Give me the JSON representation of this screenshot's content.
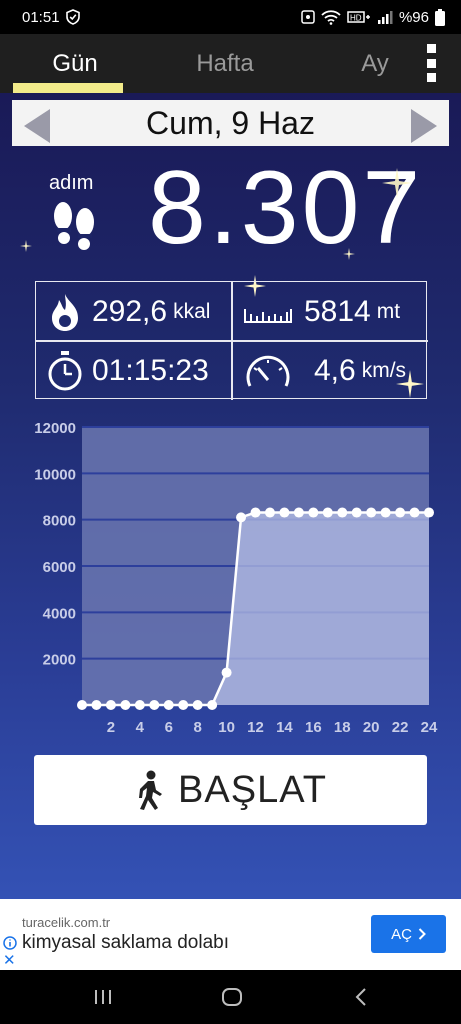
{
  "status_bar": {
    "time": "01:51",
    "battery": "%96",
    "icons": [
      "shield-check-icon",
      "alarm-icon",
      "wifi-icon",
      "volte-icon",
      "signal-icon",
      "battery-icon"
    ]
  },
  "tabs": [
    {
      "label": "Gün",
      "active": true
    },
    {
      "label": "Hafta",
      "active": false
    },
    {
      "label": "Ay",
      "active": false
    }
  ],
  "date": {
    "label": "Cum, 9 Haz"
  },
  "steps": {
    "label": "adım",
    "value": "8.307"
  },
  "stats": {
    "calories": {
      "value": "292,6",
      "unit": "kkal",
      "icon": "flame-icon"
    },
    "distance": {
      "value": "5814",
      "unit": "mt",
      "icon": "ruler-icon"
    },
    "duration": {
      "value": "01:15:23",
      "icon": "stopwatch-icon"
    },
    "speed": {
      "value": "4,6",
      "unit": "km/s",
      "icon": "speedometer-icon"
    }
  },
  "chart_data": {
    "type": "area",
    "x": [
      0,
      1,
      2,
      3,
      4,
      5,
      6,
      7,
      8,
      9,
      10,
      11,
      12,
      13,
      14,
      15,
      16,
      17,
      18,
      19,
      20,
      21,
      22,
      23,
      24
    ],
    "values": [
      0,
      0,
      0,
      0,
      0,
      0,
      0,
      0,
      0,
      0,
      1400,
      8100,
      8307,
      8307,
      8307,
      8307,
      8307,
      8307,
      8307,
      8307,
      8307,
      8307,
      8307,
      8307,
      8307
    ],
    "xticks": [
      "2",
      "4",
      "6",
      "8",
      "10",
      "12",
      "14",
      "16",
      "18",
      "20",
      "22",
      "24"
    ],
    "yticks": [
      "2000",
      "4000",
      "6000",
      "8000",
      "10000",
      "12000"
    ],
    "xlim": [
      0,
      24
    ],
    "ylim": [
      0,
      12000
    ],
    "grid": true,
    "colors": {
      "fill": "#b4bee6",
      "line": "#ffffff",
      "grid": "#2d3f9c",
      "plot_bg": "#6b77b0"
    }
  },
  "start_button": {
    "label": "BAŞLAT",
    "icon": "walking-icon"
  },
  "ad": {
    "domain": "turacelik.com.tr",
    "title": "kimyasal saklama dolabı",
    "button": "AÇ",
    "close": "✕"
  },
  "nav": {
    "icons": [
      "recent-apps-icon",
      "home-icon",
      "back-icon"
    ]
  }
}
